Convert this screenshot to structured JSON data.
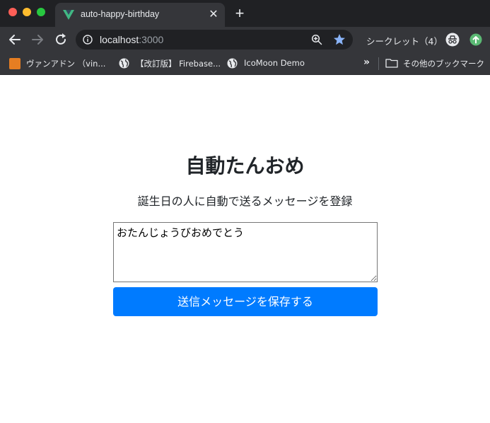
{
  "browser": {
    "tab": {
      "title": "auto-happy-birthday",
      "close_glyph": "✕",
      "favicon": "vue-logo-icon"
    },
    "new_tab_glyph": "+",
    "address_bar": {
      "host": "localhost",
      "port": ":3000"
    },
    "incognito_label": "シークレット（4）",
    "bookmarks": [
      {
        "label": "ヴァンアドン （vin...",
        "icon": "site-logo-icon"
      },
      {
        "label": "【改訂版】 Firebase...",
        "icon": "globe-icon"
      },
      {
        "label": "IcoMoon Demo",
        "icon": "globe-icon"
      }
    ],
    "more_bookmarks_glyph": "»",
    "other_bookmarks_label": "その他のブックマーク",
    "colors": {
      "frame": "#202124",
      "toolbar": "#35363a",
      "star": "#8ab4f8"
    }
  },
  "page": {
    "title": "自動たんおめ",
    "subtitle": "誕生日の人に自動で送るメッセージを登録",
    "message_value": "おたんじょうびおめでとう",
    "save_button_label": "送信メッセージを保存する",
    "colors": {
      "primary": "#007bff",
      "text": "#212529"
    }
  }
}
